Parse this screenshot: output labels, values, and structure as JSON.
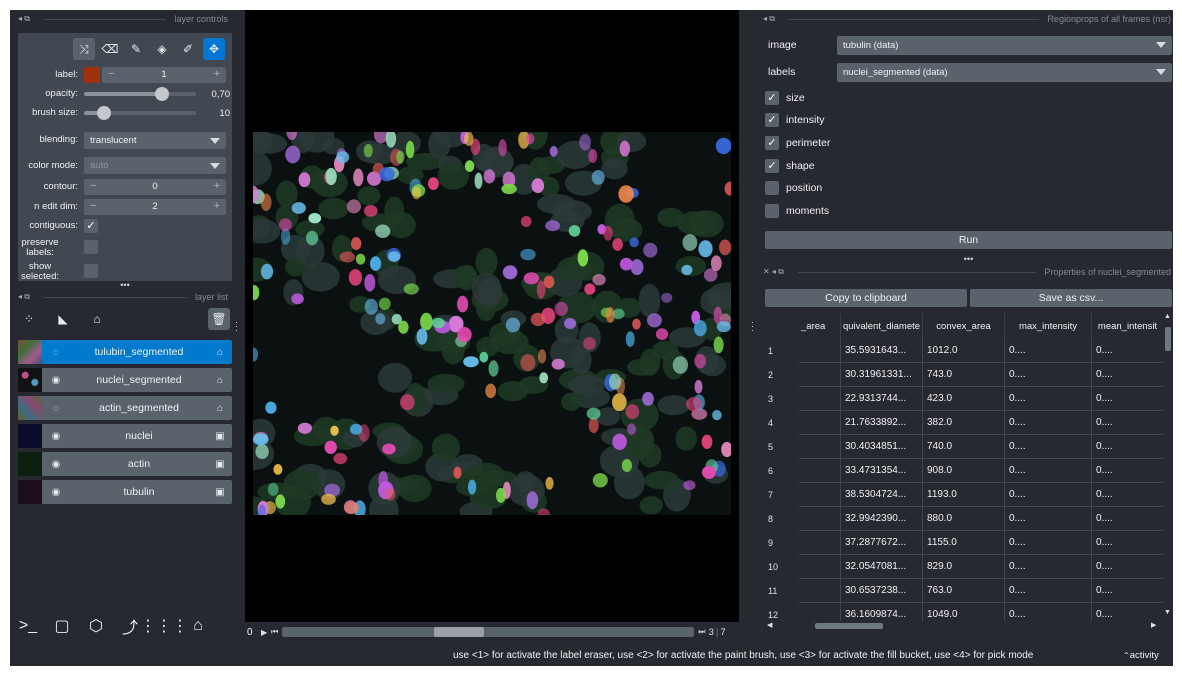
{
  "layer_controls": {
    "title": "layer controls",
    "label": {
      "label": "label:",
      "value": "1",
      "minus": "−",
      "plus": "+",
      "swatch": "#a0300d"
    },
    "opacity": {
      "label": "opacity:",
      "value": "0,70",
      "level": 0.7
    },
    "brush_size": {
      "label": "brush size:",
      "value": "10",
      "level": 0.18
    },
    "blending": {
      "label": "blending:",
      "value": "translucent"
    },
    "color_mode": {
      "label": "color mode:",
      "value": "auto"
    },
    "contour": {
      "label": "contour:",
      "value": "0",
      "minus": "−",
      "plus": "+"
    },
    "n_edit_dim": {
      "label": "n edit dim:",
      "value": "2",
      "minus": "−",
      "plus": "+"
    },
    "contiguous": {
      "label": "contiguous:",
      "checked": true
    },
    "preserve_labels": {
      "label": "preserve labels:",
      "checked": false
    },
    "show_selected": {
      "label": "show selected:",
      "checked": false
    },
    "tools": [
      "shuffle-icon",
      "eraser-icon",
      "paint-brush-icon",
      "fill-bucket-icon",
      "color-picker-icon",
      "pan-zoom-icon"
    ],
    "more": "•••"
  },
  "layer_list": {
    "title": "layer list",
    "layers": [
      {
        "name": "tulubin_segmented",
        "type": "labels",
        "visible": false,
        "selected": true
      },
      {
        "name": "nuclei_segmented",
        "type": "labels",
        "visible": true,
        "selected": false
      },
      {
        "name": "actin_segmented",
        "type": "labels",
        "visible": false,
        "selected": false
      },
      {
        "name": "nuclei",
        "type": "image",
        "visible": true,
        "selected": false
      },
      {
        "name": "actin",
        "type": "image",
        "visible": true,
        "selected": false
      },
      {
        "name": "tubulin",
        "type": "image",
        "visible": true,
        "selected": false
      }
    ]
  },
  "dims": {
    "current": "0",
    "position": "3",
    "total": "7"
  },
  "regionprops": {
    "title": "Regionprops of all frames (nsr)",
    "image_label": "image",
    "image_value": "tubulin (data)",
    "labels_label": "labels",
    "labels_value": "nuclei_segmented (data)",
    "checkboxes": [
      {
        "label": "size",
        "checked": true
      },
      {
        "label": "intensity",
        "checked": true
      },
      {
        "label": "perimeter",
        "checked": true
      },
      {
        "label": "shape",
        "checked": true
      },
      {
        "label": "position",
        "checked": false
      },
      {
        "label": "moments",
        "checked": false
      }
    ],
    "run": "Run",
    "more": "•••"
  },
  "properties": {
    "title": "Properties of nuclei_segmented",
    "copy": "Copy to clipboard",
    "save": "Save as csv...",
    "columns": [
      "_area",
      "quivalent_diamete",
      "convex_area",
      "max_intensity",
      "mean_intensit"
    ],
    "rows": [
      {
        "n": "1",
        "cells": [
          "",
          "35.5931643...",
          "1012.0",
          "0....",
          "0...."
        ]
      },
      {
        "n": "2",
        "cells": [
          "",
          "30.31961331...",
          "743.0",
          "0....",
          "0...."
        ]
      },
      {
        "n": "3",
        "cells": [
          "",
          "22.9313744...",
          "423.0",
          "0....",
          "0...."
        ]
      },
      {
        "n": "4",
        "cells": [
          "",
          "21.7633892...",
          "382.0",
          "0....",
          "0...."
        ]
      },
      {
        "n": "5",
        "cells": [
          "",
          "30.4034851...",
          "740.0",
          "0....",
          "0...."
        ]
      },
      {
        "n": "6",
        "cells": [
          "",
          "33.4731354...",
          "908.0",
          "0....",
          "0...."
        ]
      },
      {
        "n": "7",
        "cells": [
          "",
          "38.5304724...",
          "1193.0",
          "0....",
          "0...."
        ]
      },
      {
        "n": "8",
        "cells": [
          "",
          "32.9942390...",
          "880.0",
          "0....",
          "0...."
        ]
      },
      {
        "n": "9",
        "cells": [
          "",
          "37.2877672...",
          "1155.0",
          "0....",
          "0...."
        ]
      },
      {
        "n": "10",
        "cells": [
          "",
          "32.0547081...",
          "829.0",
          "0....",
          "0...."
        ]
      },
      {
        "n": "11",
        "cells": [
          "",
          "30.6537238...",
          "763.0",
          "0....",
          "0...."
        ]
      },
      {
        "n": "12",
        "cells": [
          "",
          "36.1609874...",
          "1049.0",
          "0....",
          "0...."
        ]
      }
    ]
  },
  "status": {
    "message": "use <1> for activate the label eraser, use <2> for activate the paint brush, use <3> for activate the fill bucket, use <4> for pick mode",
    "activity": "activity"
  }
}
